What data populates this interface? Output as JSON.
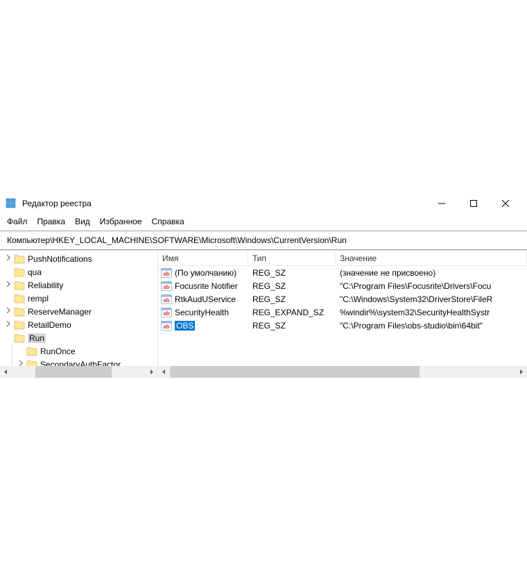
{
  "window": {
    "title": "Редактор реестра"
  },
  "menu": {
    "file": "Файл",
    "edit": "Правка",
    "view": "Вид",
    "favorites": "Избранное",
    "help": "Справка"
  },
  "address": "Компьютер\\HKEY_LOCAL_MACHINE\\SOFTWARE\\Microsoft\\Windows\\CurrentVersion\\Run",
  "tree": {
    "items": [
      {
        "label": "PushNotifications",
        "expandable": true,
        "selected": false,
        "indent": false
      },
      {
        "label": "qua",
        "expandable": false,
        "selected": false,
        "indent": false
      },
      {
        "label": "Reliability",
        "expandable": true,
        "selected": false,
        "indent": false
      },
      {
        "label": "rempl",
        "expandable": false,
        "selected": false,
        "indent": false
      },
      {
        "label": "ReserveManager",
        "expandable": true,
        "selected": false,
        "indent": false
      },
      {
        "label": "RetailDemo",
        "expandable": true,
        "selected": false,
        "indent": false
      },
      {
        "label": "Run",
        "expandable": false,
        "selected": true,
        "indent": false
      },
      {
        "label": "RunOnce",
        "expandable": false,
        "selected": false,
        "indent": true
      },
      {
        "label": "SecondaryAuthFactor",
        "expandable": true,
        "selected": false,
        "indent": true
      }
    ]
  },
  "list": {
    "headers": {
      "name": "Имя",
      "type": "Тип",
      "value": "Значение"
    },
    "rows": [
      {
        "name": "(По умолчанию)",
        "type": "REG_SZ",
        "value": "(значение не присвоено)",
        "selected": false
      },
      {
        "name": "Focusrite Notifier",
        "type": "REG_SZ",
        "value": "\"C:\\Program Files\\Focusrite\\Drivers\\Focu",
        "selected": false
      },
      {
        "name": "RtkAudUService",
        "type": "REG_SZ",
        "value": "\"C:\\Windows\\System32\\DriverStore\\FileR",
        "selected": false
      },
      {
        "name": "SecurityHealth",
        "type": "REG_EXPAND_SZ",
        "value": "%windir%\\system32\\SecurityHealthSystr",
        "selected": false
      },
      {
        "name": "OBS",
        "type": "REG_SZ",
        "value": "\"C:\\Program Files\\obs-studio\\bin\\64bit\"",
        "selected": true
      }
    ]
  }
}
